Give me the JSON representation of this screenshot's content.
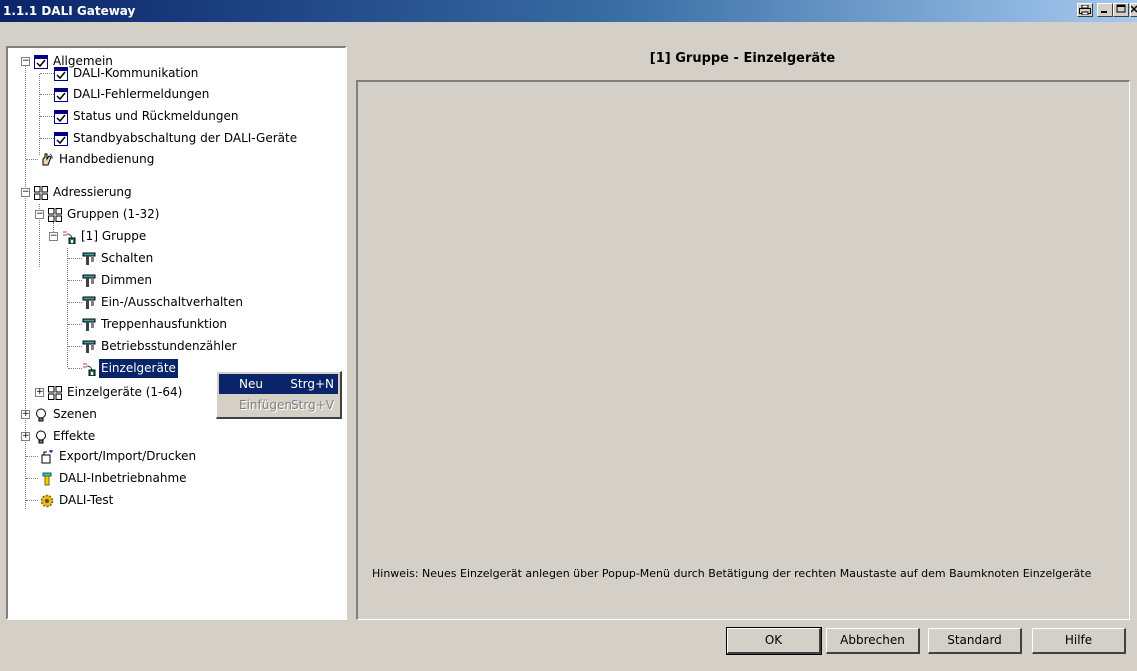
{
  "window": {
    "title": "1.1.1 DALI Gateway"
  },
  "tree": {
    "items": [
      {
        "label": "Allgemein",
        "icon": "checklist-icon"
      },
      {
        "label": "DALI-Kommunikation",
        "icon": "checklist-icon"
      },
      {
        "label": "DALI-Fehlermeldungen",
        "icon": "checklist-icon"
      },
      {
        "label": "Status und Rückmeldungen",
        "icon": "checklist-icon"
      },
      {
        "label": "Standbyabschaltung der DALI-Geräte",
        "icon": "checklist-icon"
      },
      {
        "label": "Handbedienung",
        "icon": "hand-icon"
      },
      {
        "label": "Adressierung",
        "icon": "grid-icon"
      },
      {
        "label": "Gruppen (1-32)",
        "icon": "grid-icon"
      },
      {
        "label": "[1] Gruppe",
        "icon": "group-icon"
      },
      {
        "label": "Schalten",
        "icon": "tool-icon"
      },
      {
        "label": "Dimmen",
        "icon": "tool-icon"
      },
      {
        "label": "Ein-/Ausschaltverhalten",
        "icon": "tool-icon"
      },
      {
        "label": "Treppenhausfunktion",
        "icon": "tool-icon"
      },
      {
        "label": "Betriebsstundenzähler",
        "icon": "tool-icon"
      },
      {
        "label": "Einzelgeräte",
        "icon": "group-icon"
      },
      {
        "label": "Einzelgeräte (1-64)",
        "icon": "grid-icon"
      },
      {
        "label": "Szenen",
        "icon": "bulb-icon"
      },
      {
        "label": "Effekte",
        "icon": "bulb-icon"
      },
      {
        "label": "Export/Import/Drucken",
        "icon": "export-icon"
      },
      {
        "label": "DALI-Inbetriebnahme",
        "icon": "wrench-icon"
      },
      {
        "label": "DALI-Test",
        "icon": "gear-icon"
      }
    ]
  },
  "context_menu": {
    "items": [
      {
        "label": "Neu",
        "shortcut": "Strg+N"
      },
      {
        "label": "Einfügen",
        "shortcut": "Strg+V"
      }
    ]
  },
  "main": {
    "title": "[1] Gruppe - Einzelgeräte",
    "hint": "Hinweis: Neues Einzelgerät anlegen über Popup-Menü durch Betätigung der rechten  Maustaste auf dem Baumknoten Einzelgeräte"
  },
  "buttons": {
    "ok": "OK",
    "cancel": "Abbrechen",
    "standard": "Standard",
    "help": "Hilfe"
  },
  "colors": {
    "selection": "#0a246a",
    "window_bg": "#d4d0c8",
    "title_start": "#0a246a",
    "title_end": "#a6caf0"
  }
}
